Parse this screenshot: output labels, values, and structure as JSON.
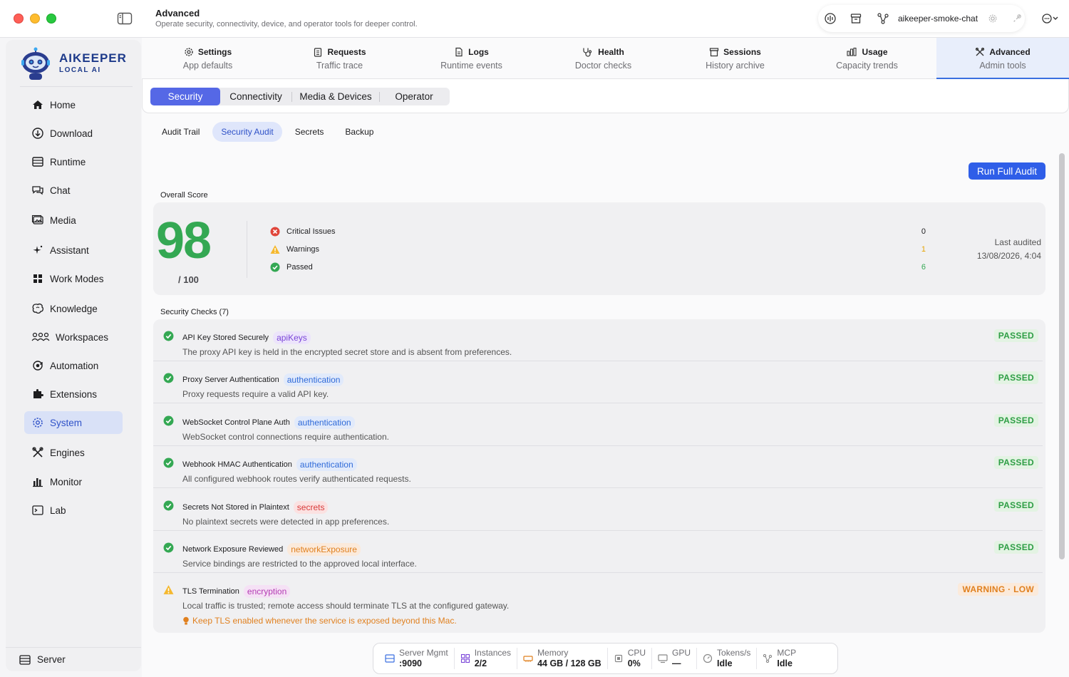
{
  "window": {
    "title": "Advanced",
    "subtitle": "Operate security, connectivity, device, and operator tools for deeper control."
  },
  "toolbar": {
    "model_label": "aikeeper-smoke-chat"
  },
  "brand": {
    "name": "AIKEEPER",
    "sub": "LOCAL AI"
  },
  "sidebar": {
    "items": [
      {
        "label": "Home",
        "icon": "home-icon"
      },
      {
        "label": "Download",
        "icon": "download-icon"
      },
      {
        "label": "Runtime",
        "icon": "runtime-icon"
      },
      {
        "label": "Chat",
        "icon": "chat-icon"
      },
      {
        "label": "Media",
        "icon": "media-icon"
      },
      {
        "label": "Assistant",
        "icon": "sparkle-icon"
      },
      {
        "label": "Work Modes",
        "icon": "grid-icon"
      },
      {
        "label": "Knowledge",
        "icon": "brain-icon"
      },
      {
        "label": "Workspaces",
        "icon": "people-icon"
      },
      {
        "label": "Automation",
        "icon": "automation-icon"
      },
      {
        "label": "Extensions",
        "icon": "extension-icon"
      },
      {
        "label": "System",
        "icon": "gear-icon"
      },
      {
        "label": "Engines",
        "icon": "tools-icon"
      },
      {
        "label": "Monitor",
        "icon": "bars-icon"
      },
      {
        "label": "Lab",
        "icon": "terminal-icon"
      }
    ],
    "active": "System",
    "footer": "Server"
  },
  "top_tabs": [
    {
      "name": "Settings",
      "sub": "App defaults"
    },
    {
      "name": "Requests",
      "sub": "Traffic trace"
    },
    {
      "name": "Logs",
      "sub": "Runtime events"
    },
    {
      "name": "Health",
      "sub": "Doctor checks"
    },
    {
      "name": "Sessions",
      "sub": "History archive"
    },
    {
      "name": "Usage",
      "sub": "Capacity trends"
    },
    {
      "name": "Advanced",
      "sub": "Admin tools"
    }
  ],
  "segments": [
    "Security",
    "Connectivity",
    "Media & Devices",
    "Operator"
  ],
  "subtabs": [
    "Audit Trail",
    "Security Audit",
    "Secrets",
    "Backup"
  ],
  "run_button": "Run Full Audit",
  "overall": {
    "label": "Overall Score",
    "score": "98",
    "out_of": "/ 100",
    "stats": [
      {
        "label": "Critical Issues",
        "value": "0",
        "color": "#1d1d1f"
      },
      {
        "label": "Warnings",
        "value": "1",
        "color": "#e6a300"
      },
      {
        "label": "Passed",
        "value": "6",
        "color": "#34a853"
      }
    ],
    "last_audited_label": "Last audited",
    "last_audited_value": "13/08/2026, 4:04"
  },
  "checks_label": "Security Checks (7)",
  "checks": [
    {
      "title": "API Key Stored Securely",
      "tag": "apiKeys",
      "desc": "The proxy API key is held in the encrypted secret store and is absent from preferences.",
      "status": "PASSED"
    },
    {
      "title": "Proxy Server Authentication",
      "tag": "authentication",
      "desc": "Proxy requests require a valid API key.",
      "status": "PASSED"
    },
    {
      "title": "WebSocket Control Plane Auth",
      "tag": "authentication",
      "desc": "WebSocket control connections require authentication.",
      "status": "PASSED"
    },
    {
      "title": "Webhook HMAC Authentication",
      "tag": "authentication",
      "desc": "All configured webhook routes verify authenticated requests.",
      "status": "PASSED"
    },
    {
      "title": "Secrets Not Stored in Plaintext",
      "tag": "secrets",
      "desc": "No plaintext secrets were detected in app preferences.",
      "status": "PASSED"
    },
    {
      "title": "Network Exposure Reviewed",
      "tag": "networkExposure",
      "desc": "Service bindings are restricted to the approved local interface.",
      "status": "PASSED"
    },
    {
      "title": "TLS Termination",
      "tag": "encryption",
      "desc": "Local traffic is trusted; remote access should terminate TLS at the configured gateway.",
      "status": "WARNING · LOW",
      "hint": "Keep TLS enabled whenever the service is exposed beyond this Mac."
    }
  ],
  "tag_colors": {
    "apiKeys": {
      "bg": "#ece4fb",
      "fg": "#7a45d8"
    },
    "authentication": {
      "bg": "#e1eafb",
      "fg": "#2f6ad8"
    },
    "secrets": {
      "bg": "#fbe1e1",
      "fg": "#d83a3a"
    },
    "networkExposure": {
      "bg": "#fbeadb",
      "fg": "#e0801f"
    },
    "encryption": {
      "bg": "#f5e1f5",
      "fg": "#b33bb3"
    }
  },
  "status_bar": [
    {
      "label": "Server Mgmt",
      "value": ":9090",
      "icon": "server-icon"
    },
    {
      "label": "Instances",
      "value": "2/2",
      "icon": "instances-icon"
    },
    {
      "label": "Memory",
      "value": "44 GB / 128 GB",
      "icon": "memory-icon"
    },
    {
      "label": "CPU",
      "value": "0%",
      "icon": "cpu-icon"
    },
    {
      "label": "GPU",
      "value": "—",
      "icon": "gpu-icon"
    },
    {
      "label": "Tokens/s",
      "value": "Idle",
      "icon": "gauge-icon"
    },
    {
      "label": "MCP",
      "value": "Idle",
      "icon": "mcp-icon"
    }
  ]
}
